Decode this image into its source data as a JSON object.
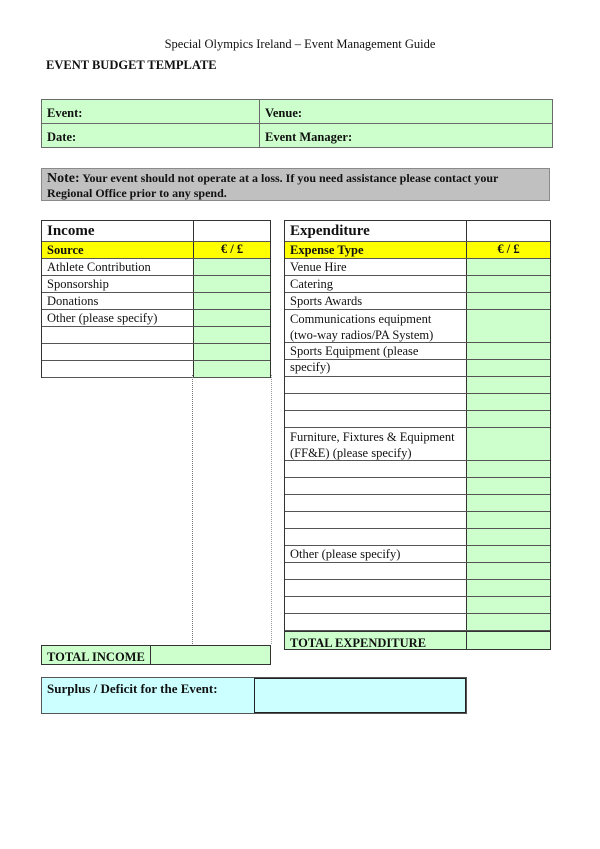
{
  "document": {
    "header": "Special Olympics Ireland – Event Management Guide",
    "title": "EVENT BUDGET TEMPLATE"
  },
  "info": {
    "event_label": "Event:",
    "venue_label": "Venue:",
    "date_label": "Date:",
    "manager_label": "Event Manager:"
  },
  "note": {
    "label": "Note:",
    "text": " Your event should not operate at a loss.  If you need assistance please contact your Regional Office prior to any spend."
  },
  "income": {
    "title": "Income",
    "col_source": "Source",
    "col_amount": "€ / £",
    "rows": [
      "Athlete Contribution",
      "Sponsorship",
      "Donations",
      "Other (please specify)",
      "",
      "",
      ""
    ],
    "total_label": "TOTAL INCOME"
  },
  "expenditure": {
    "title": "Expenditure",
    "col_type": "Expense Type",
    "col_amount": "€ / £",
    "rows": [
      "Venue Hire",
      "Catering",
      "Sports Awards",
      "Communications equipment (two-way radios/PA System)",
      "Sports Equipment (please specify)",
      "",
      "",
      "",
      "",
      "Furniture, Fixtures & Equipment (FF&E) (please specify)",
      "",
      "",
      "",
      "",
      "",
      "Other (please specify)",
      "",
      "",
      "",
      ""
    ],
    "total_label": "TOTAL EXPENDITURE"
  },
  "surplus": {
    "label": "Surplus / Deficit for the Event:"
  },
  "colors": {
    "input_green": "#ccffcc",
    "header_yellow": "#ffff00",
    "note_gray": "#c0c0c0",
    "surplus_cyan": "#ccffff"
  }
}
